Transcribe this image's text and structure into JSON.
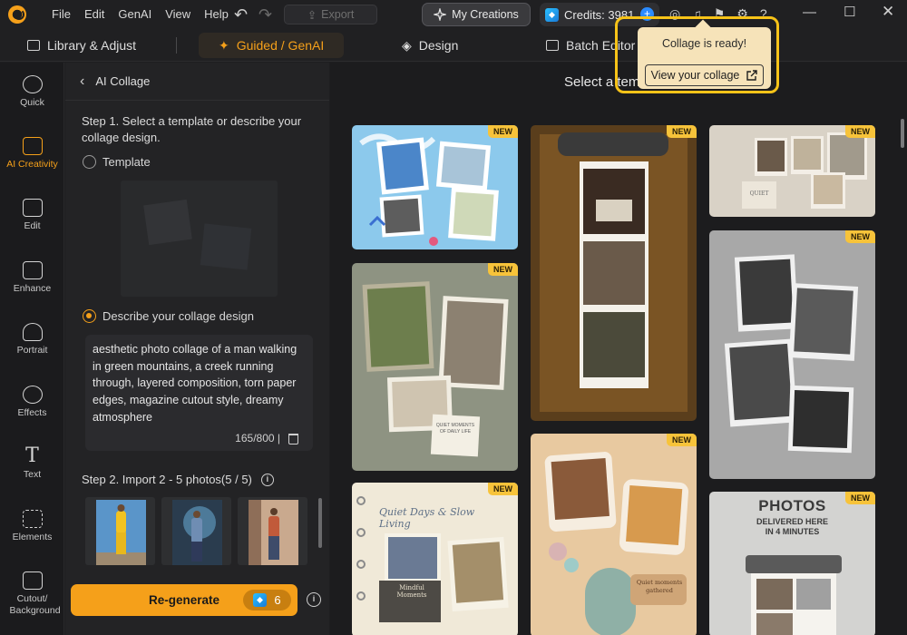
{
  "menu": [
    "File",
    "Edit",
    "GenAI",
    "View",
    "Help"
  ],
  "toolbar": {
    "export_label": "Export",
    "creations_label": "My Creations",
    "credits_label": "Credits: 3981"
  },
  "tabs": [
    "Library & Adjust",
    "Guided / GenAI",
    "Design",
    "Batch Editor"
  ],
  "rail": [
    "Quick",
    "AI Creativity",
    "Edit",
    "Enhance",
    "Portrait",
    "Effects",
    "Text",
    "Elements",
    "Cutout/ Background"
  ],
  "panel": {
    "title": "AI Collage",
    "step1": "Step 1. Select a template or describe your collage design.",
    "template_label": "Template",
    "describe_label": "Describe your collage design",
    "description": "aesthetic photo collage of a man walking in green mountains, a creek running through, layered composition, torn paper edges, magazine cutout style, dreamy atmosphere",
    "char_count": "165/800 |",
    "step2": "Step 2. Import 2 - 5 photos(5 / 5)",
    "regen_label": "Re-generate",
    "regen_cost": "6"
  },
  "main": {
    "select_title": "Select a tem",
    "badge": "NEW",
    "card_texts": {
      "quiet_moments": "QUIET MOMENTS OF DAILY LIFE",
      "quiet_days": "Quiet Days & Slow Living",
      "mindful": "Mindful Moments",
      "quiet_gathered": "Quiet moments gathered",
      "photos_title": "PHOTOS",
      "photos_sub": "DELIVERED HERE IN 4 MINUTES",
      "quiet_small": "QUIET"
    }
  },
  "toast": {
    "title": "Collage is ready!",
    "button": "View your collage"
  },
  "colors": {
    "accent": "#f5a01a",
    "badge": "#f7c33a",
    "highlight": "#f7c318"
  }
}
